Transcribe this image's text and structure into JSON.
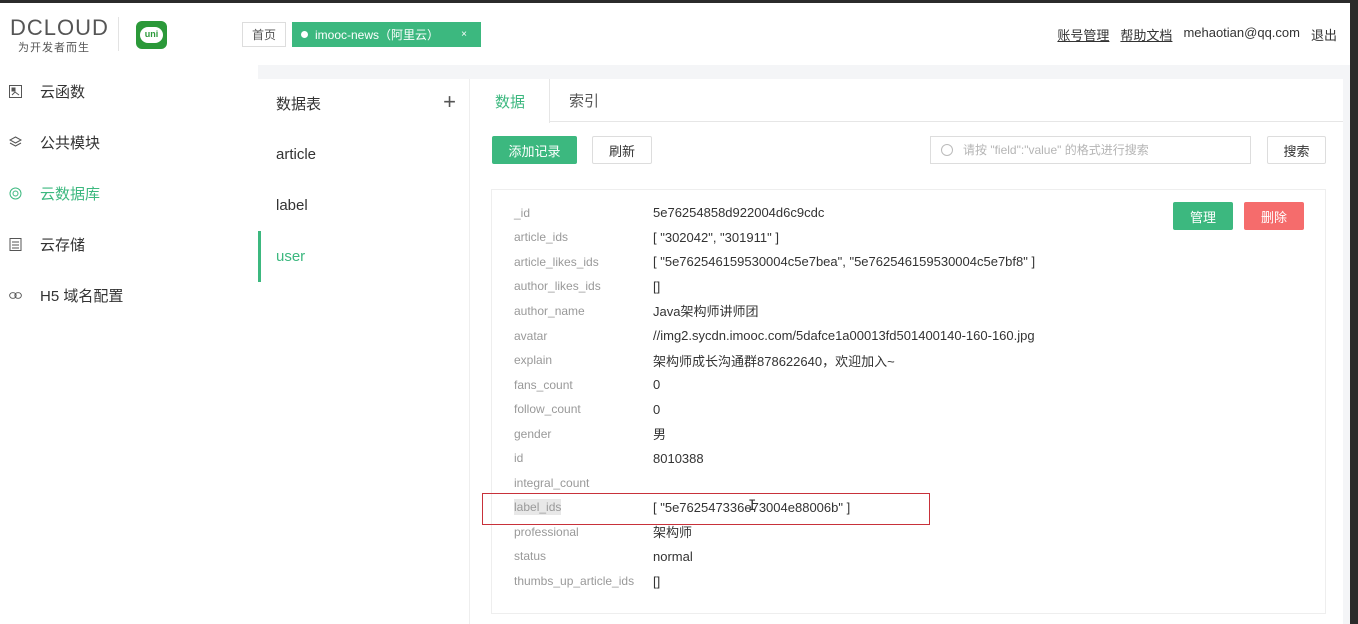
{
  "header": {
    "logo_text": "DCLOUD",
    "logo_sub": "为开发者而生",
    "uni_logo_text": "uni",
    "tabs": [
      {
        "label": "首页"
      },
      {
        "label": "imooc-news（阿里云）",
        "close": "×"
      }
    ],
    "links": {
      "account": "账号管理",
      "help": "帮助文档",
      "email": "mehaotian@qq.com",
      "logout": "退出"
    }
  },
  "sidebar": {
    "items": [
      {
        "label": "云函数",
        "icon": "cloud-function-icon"
      },
      {
        "label": "公共模块",
        "icon": "layers-icon"
      },
      {
        "label": "云数据库",
        "icon": "database-icon",
        "active": true
      },
      {
        "label": "云存储",
        "icon": "storage-icon"
      },
      {
        "label": "H5 域名配置",
        "icon": "link-icon"
      }
    ]
  },
  "tables": {
    "title": "数据表",
    "add_icon": "plus-icon",
    "items": [
      {
        "name": "article"
      },
      {
        "name": "label"
      },
      {
        "name": "user",
        "active": true
      }
    ]
  },
  "content_tabs": [
    {
      "label": "数据",
      "active": true
    },
    {
      "label": "索引"
    }
  ],
  "toolbar": {
    "add_label": "添加记录",
    "refresh_label": "刷新",
    "search_placeholder": "请按 \"field\":\"value\" 的格式进行搜索",
    "search_label": "搜索"
  },
  "record": {
    "manage_label": "管理",
    "delete_label": "删除",
    "fields": [
      {
        "key": "_id",
        "value": "5e76254858d922004d6c9cdc"
      },
      {
        "key": "article_ids",
        "value": "[ \"302042\", \"301911\" ]"
      },
      {
        "key": "article_likes_ids",
        "value": "[ \"5e762546159530004c5e7bea\", \"5e762546159530004c5e7bf8\" ]"
      },
      {
        "key": "author_likes_ids",
        "value": "[]"
      },
      {
        "key": "author_name",
        "value": "Java架构师讲师团"
      },
      {
        "key": "avatar",
        "value": "//img2.sycdn.imooc.com/5dafce1a00013fd501400140-160-160.jpg"
      },
      {
        "key": "explain",
        "value": "架构师成长沟通群878622640，欢迎加入~"
      },
      {
        "key": "fans_count",
        "value": "0"
      },
      {
        "key": "follow_count",
        "value": "0"
      },
      {
        "key": "gender",
        "value": "男"
      },
      {
        "key": "id",
        "value": "8010388"
      },
      {
        "key": "integral_count",
        "value": ""
      },
      {
        "key": "label_ids",
        "value": "[ \"5e762547336e73004e88006b\" ]",
        "highlighted": true
      },
      {
        "key": "professional",
        "value": "架构师"
      },
      {
        "key": "status",
        "value": "normal"
      },
      {
        "key": "thumbs_up_article_ids",
        "value": "[]"
      }
    ]
  },
  "colors": {
    "accent": "#3cb87f",
    "danger": "#f56c6c",
    "annotation": "#c8313a"
  }
}
